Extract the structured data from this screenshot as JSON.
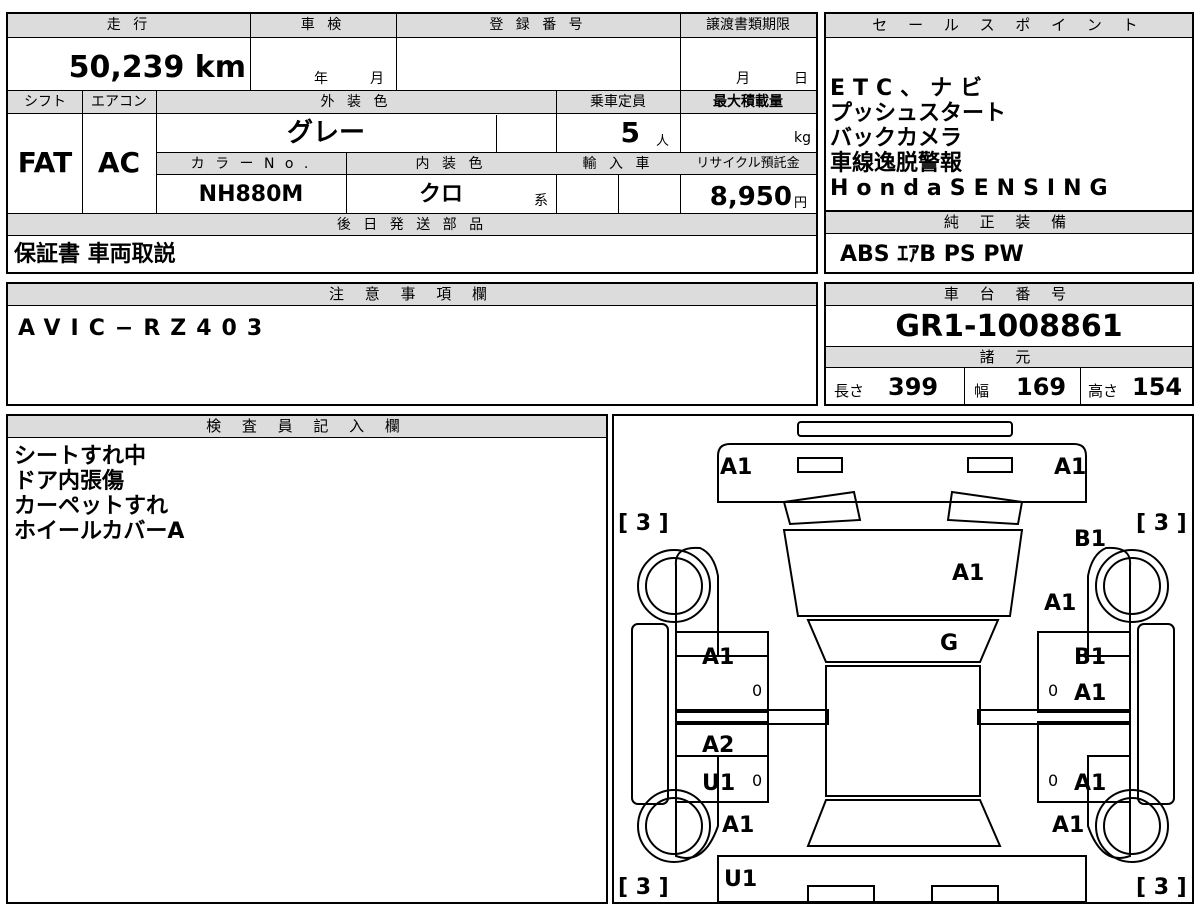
{
  "header_top": {
    "mileage_label": "走 行",
    "shaken_label": "車 検",
    "reg_label": "登 録 番 号",
    "transfer_label": "譲渡書類期限",
    "mileage_value": "50,239 km",
    "shaken_year": "年",
    "shaken_month": "月",
    "transfer_month": "月",
    "transfer_day": "日"
  },
  "header_mid": {
    "shift_label": "シフト",
    "ac_label": "エアコン",
    "ext_color_label": "外 装 色",
    "capacity_label": "乗車定員",
    "max_load_label": "最大積載量",
    "shift_value": "FAT",
    "ac_value": "AC",
    "ext_color_value": "グレー",
    "capacity_value": "5",
    "capacity_unit": "人",
    "max_load_unit": "kg",
    "color_no_label": "カ ラ ー N o .",
    "int_color_label": "内 装 色",
    "import_label": "輸 入 車",
    "recycle_label": "リサイクル預託金",
    "color_no_value": "NH880M",
    "int_color_value": "クロ",
    "int_color_suffix": "系",
    "recycle_value": "8,950",
    "recycle_unit": "円"
  },
  "later_parts": {
    "label": "後 日 発 送 部 品",
    "value": "保証書 車両取説"
  },
  "notes": {
    "label": "注 意 事 項 欄",
    "value": "AVIC−RZ403"
  },
  "inspector": {
    "label": "検 査 員 記 入 欄",
    "lines": [
      "シートすれ中",
      "ドア内張傷",
      "カーペットすれ",
      "ホイールカバーA"
    ]
  },
  "sales_points": {
    "label": "セ ー ル ス ポ イ ン ト",
    "items": [
      "ETC、ナビ",
      "プッシュスタート",
      "バックカメラ",
      "車線逸脱警報",
      "HondaSENSING"
    ]
  },
  "genuine": {
    "label": "純 正 装 備",
    "value": "ABS ｴｱB PS PW"
  },
  "chassis": {
    "label": "車 台 番 号",
    "value": "GR1-1008861"
  },
  "specs": {
    "label": "諸 元",
    "length_label": "長さ",
    "length_value": "399",
    "width_label": "幅",
    "width_value": "169",
    "height_label": "高さ",
    "height_value": "154"
  },
  "diagram": {
    "tire_marks": [
      "[ 3 ]",
      "[ 3 ]",
      "[ 3 ]",
      "[ 3 ]"
    ],
    "damage": {
      "front_left": "A1",
      "front_right": "A1",
      "fender_right": "B1",
      "hood_center": "A1",
      "hood_right": "A1",
      "windshield": "G",
      "front_door_left": "A1",
      "front_door_right_1": "B1",
      "front_door_right_2": "A1",
      "rear_door_left_1": "A2",
      "rear_door_left_2": "U1",
      "rear_door_right": "A1",
      "quarter_left": "A1",
      "quarter_right": "A1",
      "rear_bottom": "U1"
    },
    "zeros": [
      "0",
      "0",
      "0",
      "0"
    ]
  }
}
